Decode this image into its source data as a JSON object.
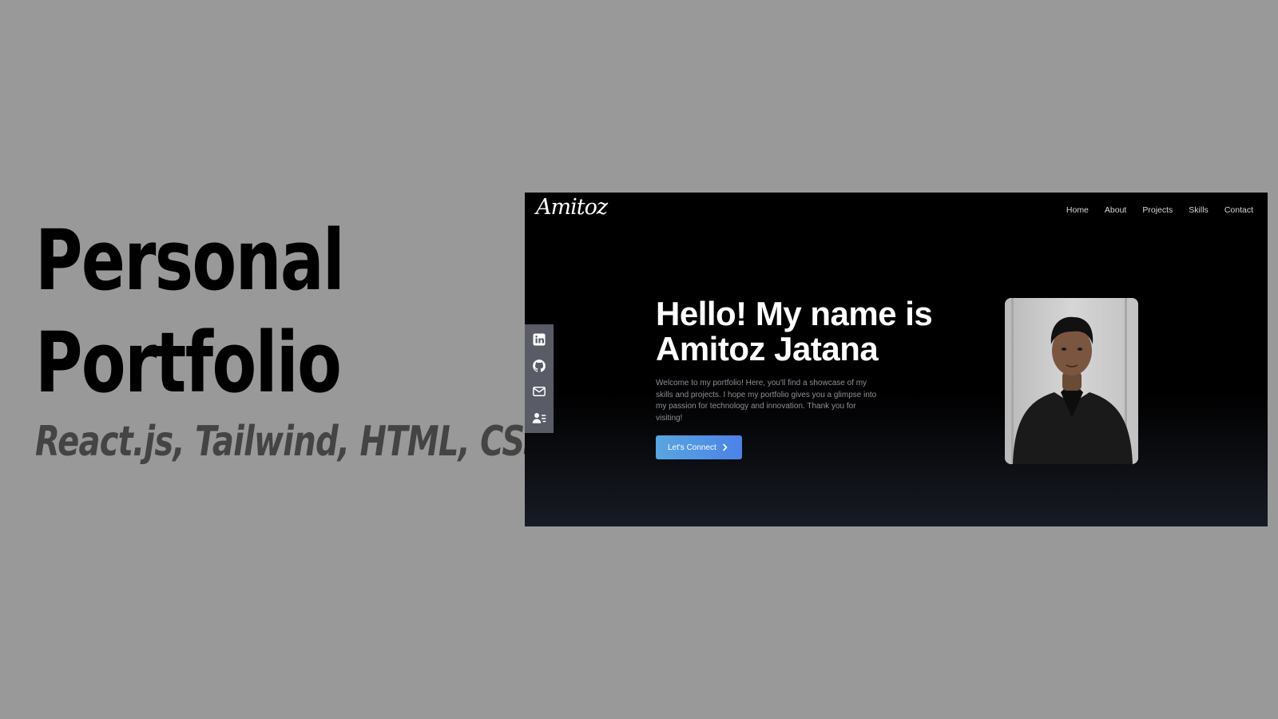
{
  "caption": {
    "title_line1": "Personal",
    "title_line2": "Portfolio",
    "subtitle": "React.js, Tailwind, HTML, CSS"
  },
  "site": {
    "logo": "Amitoz",
    "nav": [
      "Home",
      "About",
      "Projects",
      "Skills",
      "Contact"
    ],
    "social_icons": [
      "linkedin-icon",
      "github-icon",
      "mail-icon",
      "resume-icon"
    ],
    "hero": {
      "title_line1": "Hello! My name is",
      "title_line2": "Amitoz Jatana",
      "intro": "Welcome to my portfolio! Here, you'll find a showcase of my skills and projects. I hope my portfolio gives you a glimpse into my passion for technology and innovation. Thank you for visiting!",
      "cta_label": "Let's Connect"
    },
    "colors": {
      "background": "#000000",
      "cta_start": "#58a6e0",
      "cta_end": "#4b82e8",
      "social_bar": "#595c66"
    }
  }
}
